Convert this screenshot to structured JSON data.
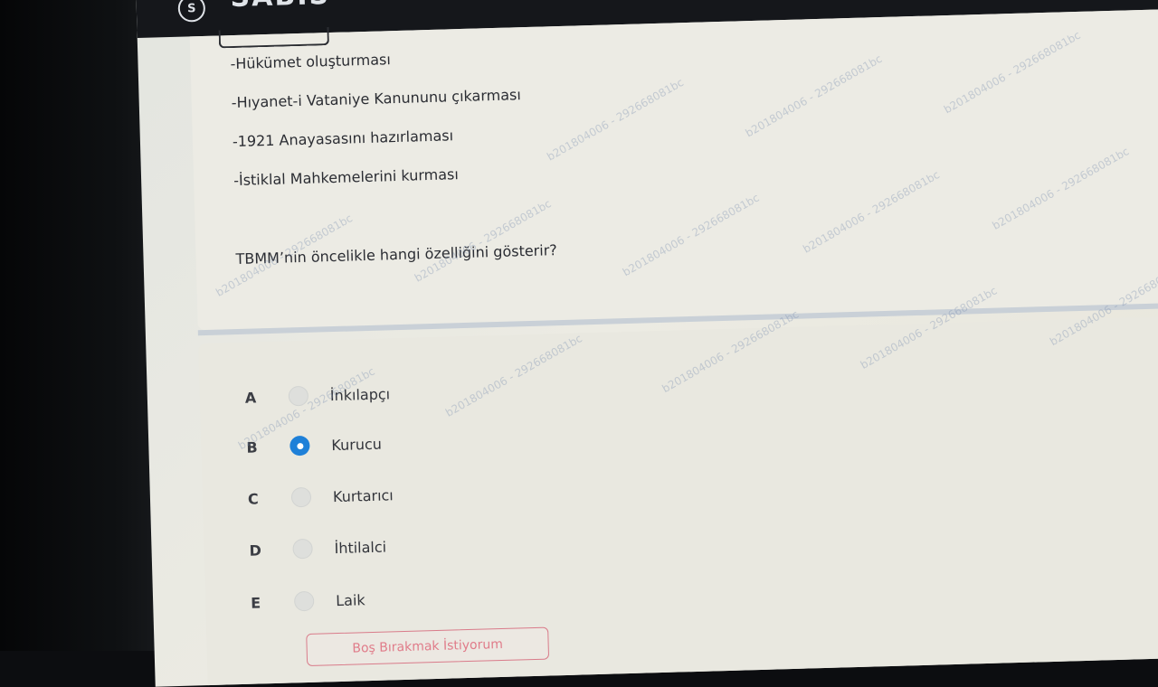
{
  "app": {
    "brand": "SABIS"
  },
  "question": {
    "lines": [
      "-Hükümet oluşturması",
      "-Hıyanet-i Vataniye Kanununu çıkarması",
      "-1921 Anayasasını hazırlaması",
      "-İstiklal Mahkemelerini kurması"
    ],
    "prompt": "TBMM’nin öncelikle hangi özelliğini gösterir?"
  },
  "options": [
    {
      "letter": "A",
      "label": "İnkılapçı",
      "selected": false
    },
    {
      "letter": "B",
      "label": "Kurucu",
      "selected": true
    },
    {
      "letter": "C",
      "label": "Kurtarıcı",
      "selected": false
    },
    {
      "letter": "D",
      "label": "İhtilalci",
      "selected": false
    },
    {
      "letter": "E",
      "label": "Laik",
      "selected": false
    }
  ],
  "leave_blank_button": "Boş Bırakmak İstiyorum",
  "watermark": "b201804006 - 292668081bc",
  "colors": {
    "accent": "#1e80d8",
    "blank_button": "#e07c8a",
    "topbar": "#15171b"
  }
}
